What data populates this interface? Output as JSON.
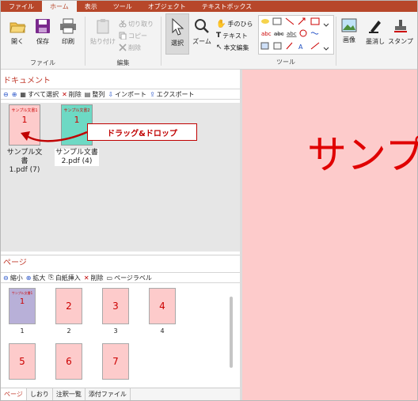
{
  "tabs": [
    "ファイル",
    "ホーム",
    "表示",
    "ツール",
    "オブジェクト",
    "テキストボックス"
  ],
  "active_tab": "ホーム",
  "ribbon": {
    "file_group": {
      "label": "ファイル",
      "open": "開く",
      "save": "保存",
      "print": "印刷"
    },
    "edit_group": {
      "label": "編集",
      "paste": "貼り付け",
      "cut": "切り取り",
      "copy": "コピー",
      "delete": "削除"
    },
    "tools_group": {
      "label": "ツール",
      "select": "選択",
      "zoom": "ズーム",
      "hand": "手のひら",
      "text": "テキスト",
      "body_edit": "本文編集"
    },
    "image": "画像",
    "redact": "墨消し",
    "stamp": "スタンプ"
  },
  "document_panel": {
    "title": "ドキュメント",
    "toolbar": [
      "すべて選択",
      "削除",
      "整列",
      "インポート",
      "エクスポート"
    ],
    "documents": [
      {
        "thumb_title": "サンプル文書1",
        "page": "1",
        "name": "サンプル文書",
        "file": "1.pdf (7)"
      },
      {
        "thumb_title": "サンプル文書2",
        "page": "1",
        "name": "サンプル文書",
        "file": "2.pdf (4)"
      }
    ],
    "callout": "ドラッグ&ドロップ"
  },
  "pages_panel": {
    "title": "ページ",
    "toolbar": [
      "縮小",
      "拡大",
      "白紙挿入",
      "削除",
      "ページラベル"
    ],
    "pages": [
      {
        "thumb": "1",
        "label": "1",
        "title": "サンプル文書1"
      },
      {
        "thumb": "2",
        "label": "2"
      },
      {
        "thumb": "3",
        "label": "3"
      },
      {
        "thumb": "4",
        "label": "4"
      },
      {
        "thumb": "5",
        "label": ""
      },
      {
        "thumb": "6",
        "label": ""
      },
      {
        "thumb": "7",
        "label": ""
      }
    ]
  },
  "bottom_tabs": [
    "ページ",
    "しおり",
    "注釈一覧",
    "添付ファイル"
  ],
  "preview": {
    "text": "サンプ"
  },
  "colors": {
    "accent": "#b7472a",
    "panel_title": "#c0392b",
    "preview_bg": "#fdcbcb",
    "preview_text": "#e00000"
  }
}
